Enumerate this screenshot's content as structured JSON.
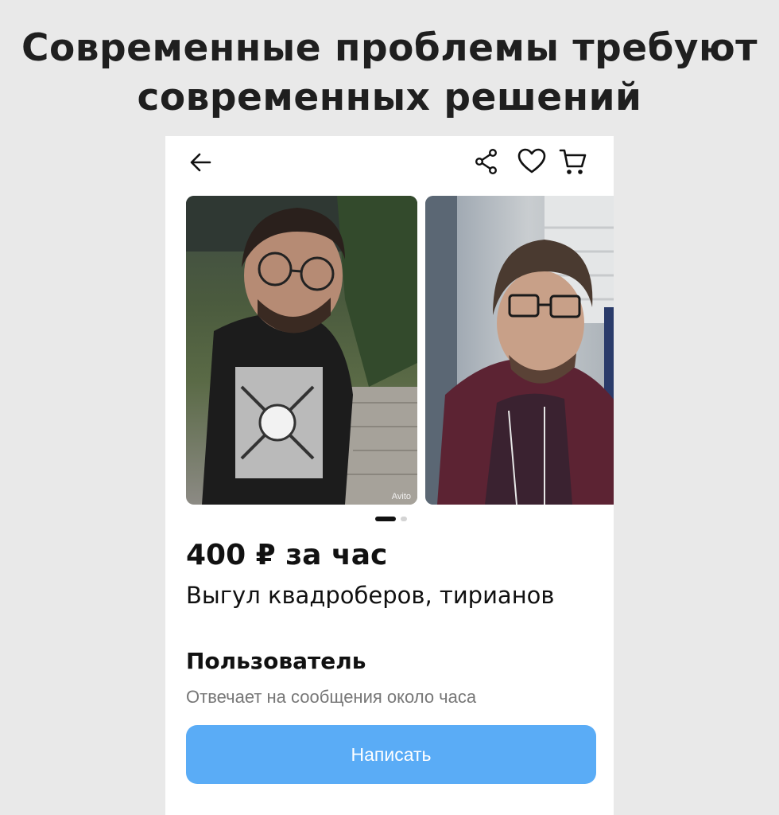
{
  "headline": {
    "line1": "Современные проблемы требуют",
    "line2": "современных решений"
  },
  "toolbar": {
    "back_icon": "arrow-left-icon",
    "share_icon": "share-icon",
    "favorite_icon": "heart-icon",
    "cart_icon": "cart-icon"
  },
  "gallery": {
    "watermark": "Avito",
    "photo_count": 2,
    "active_index": 0
  },
  "listing": {
    "price": "400 ₽ за час",
    "title": "Выгул квадроберов, тирианов"
  },
  "seller": {
    "name": "Пользователь",
    "status": "Отвечает на сообщения около часа"
  },
  "actions": {
    "write_label": "Написать"
  },
  "colors": {
    "accent": "#5aacf6",
    "background": "#e9e9e9"
  }
}
